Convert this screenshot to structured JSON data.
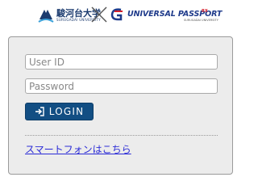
{
  "header": {
    "university_name": "駿河台大学",
    "university_subtitle": "SURUGADAI UNIVERSITY",
    "product_name": "UNIVERSAL PASSPORT",
    "product_badge": "RX",
    "product_subtitle": "SURUGADAI UNIVERSITY"
  },
  "login_form": {
    "user_id_placeholder": "User ID",
    "user_id_value": "",
    "password_placeholder": "Password",
    "password_value": "",
    "login_label": "LOGIN",
    "login_icon": "sign-in-icon"
  },
  "links": {
    "smartphone_label": "スマートフォンはこちら"
  },
  "colors": {
    "button_bg": "#124e83",
    "link": "#2b2bd6",
    "panel_bg": "#ececec",
    "brand_navy": "#1a3a6e",
    "badge_red": "#d21e2b"
  }
}
